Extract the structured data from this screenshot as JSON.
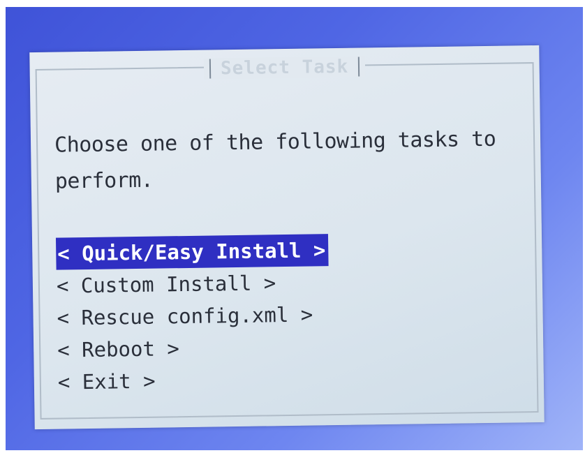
{
  "dialog": {
    "title": "Select Task",
    "prompt": "Choose one of the following tasks to perform."
  },
  "menu": {
    "items": [
      {
        "label": "< Quick/Easy Install >",
        "selected": true
      },
      {
        "label": "< Custom Install >",
        "selected": false
      },
      {
        "label": "< Rescue config.xml >",
        "selected": false
      },
      {
        "label": "< Reboot >",
        "selected": false
      },
      {
        "label": "< Exit >",
        "selected": false
      }
    ]
  },
  "colors": {
    "background": "#4f66e4",
    "dialog": "#dce6ee",
    "highlight": "#2f2fc2",
    "text": "#2a2f3a"
  }
}
